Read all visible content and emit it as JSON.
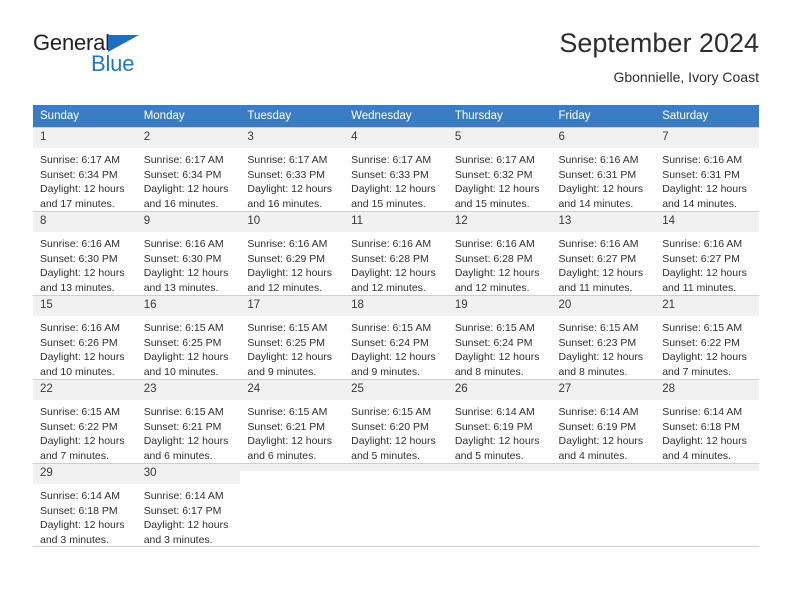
{
  "brand": {
    "name_top": "General",
    "name_bottom": "Blue",
    "triangle_icon": "blue-triangle-icon",
    "accent_color": "#1f79c8"
  },
  "header": {
    "title": "September 2024",
    "subtitle": "Gbonnielle, Ivory Coast"
  },
  "theme": {
    "header_row_bg": "#3b7dc4",
    "daynum_bg": "#f1f1f1",
    "grid_line": "#cfcfcf",
    "text": "#2f2f2f"
  },
  "weekdays": [
    "Sunday",
    "Monday",
    "Tuesday",
    "Wednesday",
    "Thursday",
    "Friday",
    "Saturday"
  ],
  "labels": {
    "sunrise_prefix": "Sunrise:",
    "sunset_prefix": "Sunset:",
    "daylight_prefix": "Daylight:"
  },
  "weeks": [
    [
      {
        "day": "1",
        "sunrise": "Sunrise: 6:17 AM",
        "sunset": "Sunset: 6:34 PM",
        "daylight": "Daylight: 12 hours and 17 minutes."
      },
      {
        "day": "2",
        "sunrise": "Sunrise: 6:17 AM",
        "sunset": "Sunset: 6:34 PM",
        "daylight": "Daylight: 12 hours and 16 minutes."
      },
      {
        "day": "3",
        "sunrise": "Sunrise: 6:17 AM",
        "sunset": "Sunset: 6:33 PM",
        "daylight": "Daylight: 12 hours and 16 minutes."
      },
      {
        "day": "4",
        "sunrise": "Sunrise: 6:17 AM",
        "sunset": "Sunset: 6:33 PM",
        "daylight": "Daylight: 12 hours and 15 minutes."
      },
      {
        "day": "5",
        "sunrise": "Sunrise: 6:17 AM",
        "sunset": "Sunset: 6:32 PM",
        "daylight": "Daylight: 12 hours and 15 minutes."
      },
      {
        "day": "6",
        "sunrise": "Sunrise: 6:16 AM",
        "sunset": "Sunset: 6:31 PM",
        "daylight": "Daylight: 12 hours and 14 minutes."
      },
      {
        "day": "7",
        "sunrise": "Sunrise: 6:16 AM",
        "sunset": "Sunset: 6:31 PM",
        "daylight": "Daylight: 12 hours and 14 minutes."
      }
    ],
    [
      {
        "day": "8",
        "sunrise": "Sunrise: 6:16 AM",
        "sunset": "Sunset: 6:30 PM",
        "daylight": "Daylight: 12 hours and 13 minutes."
      },
      {
        "day": "9",
        "sunrise": "Sunrise: 6:16 AM",
        "sunset": "Sunset: 6:30 PM",
        "daylight": "Daylight: 12 hours and 13 minutes."
      },
      {
        "day": "10",
        "sunrise": "Sunrise: 6:16 AM",
        "sunset": "Sunset: 6:29 PM",
        "daylight": "Daylight: 12 hours and 12 minutes."
      },
      {
        "day": "11",
        "sunrise": "Sunrise: 6:16 AM",
        "sunset": "Sunset: 6:28 PM",
        "daylight": "Daylight: 12 hours and 12 minutes."
      },
      {
        "day": "12",
        "sunrise": "Sunrise: 6:16 AM",
        "sunset": "Sunset: 6:28 PM",
        "daylight": "Daylight: 12 hours and 12 minutes."
      },
      {
        "day": "13",
        "sunrise": "Sunrise: 6:16 AM",
        "sunset": "Sunset: 6:27 PM",
        "daylight": "Daylight: 12 hours and 11 minutes."
      },
      {
        "day": "14",
        "sunrise": "Sunrise: 6:16 AM",
        "sunset": "Sunset: 6:27 PM",
        "daylight": "Daylight: 12 hours and 11 minutes."
      }
    ],
    [
      {
        "day": "15",
        "sunrise": "Sunrise: 6:16 AM",
        "sunset": "Sunset: 6:26 PM",
        "daylight": "Daylight: 12 hours and 10 minutes."
      },
      {
        "day": "16",
        "sunrise": "Sunrise: 6:15 AM",
        "sunset": "Sunset: 6:25 PM",
        "daylight": "Daylight: 12 hours and 10 minutes."
      },
      {
        "day": "17",
        "sunrise": "Sunrise: 6:15 AM",
        "sunset": "Sunset: 6:25 PM",
        "daylight": "Daylight: 12 hours and 9 minutes."
      },
      {
        "day": "18",
        "sunrise": "Sunrise: 6:15 AM",
        "sunset": "Sunset: 6:24 PM",
        "daylight": "Daylight: 12 hours and 9 minutes."
      },
      {
        "day": "19",
        "sunrise": "Sunrise: 6:15 AM",
        "sunset": "Sunset: 6:24 PM",
        "daylight": "Daylight: 12 hours and 8 minutes."
      },
      {
        "day": "20",
        "sunrise": "Sunrise: 6:15 AM",
        "sunset": "Sunset: 6:23 PM",
        "daylight": "Daylight: 12 hours and 8 minutes."
      },
      {
        "day": "21",
        "sunrise": "Sunrise: 6:15 AM",
        "sunset": "Sunset: 6:22 PM",
        "daylight": "Daylight: 12 hours and 7 minutes."
      }
    ],
    [
      {
        "day": "22",
        "sunrise": "Sunrise: 6:15 AM",
        "sunset": "Sunset: 6:22 PM",
        "daylight": "Daylight: 12 hours and 7 minutes."
      },
      {
        "day": "23",
        "sunrise": "Sunrise: 6:15 AM",
        "sunset": "Sunset: 6:21 PM",
        "daylight": "Daylight: 12 hours and 6 minutes."
      },
      {
        "day": "24",
        "sunrise": "Sunrise: 6:15 AM",
        "sunset": "Sunset: 6:21 PM",
        "daylight": "Daylight: 12 hours and 6 minutes."
      },
      {
        "day": "25",
        "sunrise": "Sunrise: 6:15 AM",
        "sunset": "Sunset: 6:20 PM",
        "daylight": "Daylight: 12 hours and 5 minutes."
      },
      {
        "day": "26",
        "sunrise": "Sunrise: 6:14 AM",
        "sunset": "Sunset: 6:19 PM",
        "daylight": "Daylight: 12 hours and 5 minutes."
      },
      {
        "day": "27",
        "sunrise": "Sunrise: 6:14 AM",
        "sunset": "Sunset: 6:19 PM",
        "daylight": "Daylight: 12 hours and 4 minutes."
      },
      {
        "day": "28",
        "sunrise": "Sunrise: 6:14 AM",
        "sunset": "Sunset: 6:18 PM",
        "daylight": "Daylight: 12 hours and 4 minutes."
      }
    ],
    [
      {
        "day": "29",
        "sunrise": "Sunrise: 6:14 AM",
        "sunset": "Sunset: 6:18 PM",
        "daylight": "Daylight: 12 hours and 3 minutes."
      },
      {
        "day": "30",
        "sunrise": "Sunrise: 6:14 AM",
        "sunset": "Sunset: 6:17 PM",
        "daylight": "Daylight: 12 hours and 3 minutes."
      },
      {
        "day": "",
        "sunrise": "",
        "sunset": "",
        "daylight": ""
      },
      {
        "day": "",
        "sunrise": "",
        "sunset": "",
        "daylight": ""
      },
      {
        "day": "",
        "sunrise": "",
        "sunset": "",
        "daylight": ""
      },
      {
        "day": "",
        "sunrise": "",
        "sunset": "",
        "daylight": ""
      },
      {
        "day": "",
        "sunrise": "",
        "sunset": "",
        "daylight": ""
      }
    ]
  ]
}
